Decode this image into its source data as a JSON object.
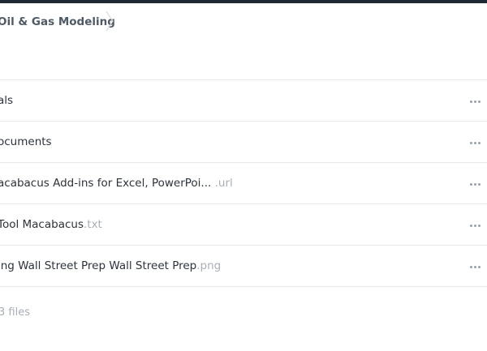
{
  "breadcrumb": {
    "current": "Oil & Gas Modeling"
  },
  "files": [
    {
      "name": "als",
      "ext": ""
    },
    {
      "name": "ocuments",
      "ext": ""
    },
    {
      "name": "acabacus Add-ins for Excel, PowerPoi...",
      "ext": " .url"
    },
    {
      "name": "Tool Macabacus",
      "ext": ".txt"
    },
    {
      "name": "ing Wall Street Prep Wall Street Prep",
      "ext": ".png"
    }
  ],
  "footer": {
    "count_text": "3 files"
  },
  "icons": {
    "more": "more-horizontal-icon",
    "separator": "chevron-right-icon"
  }
}
